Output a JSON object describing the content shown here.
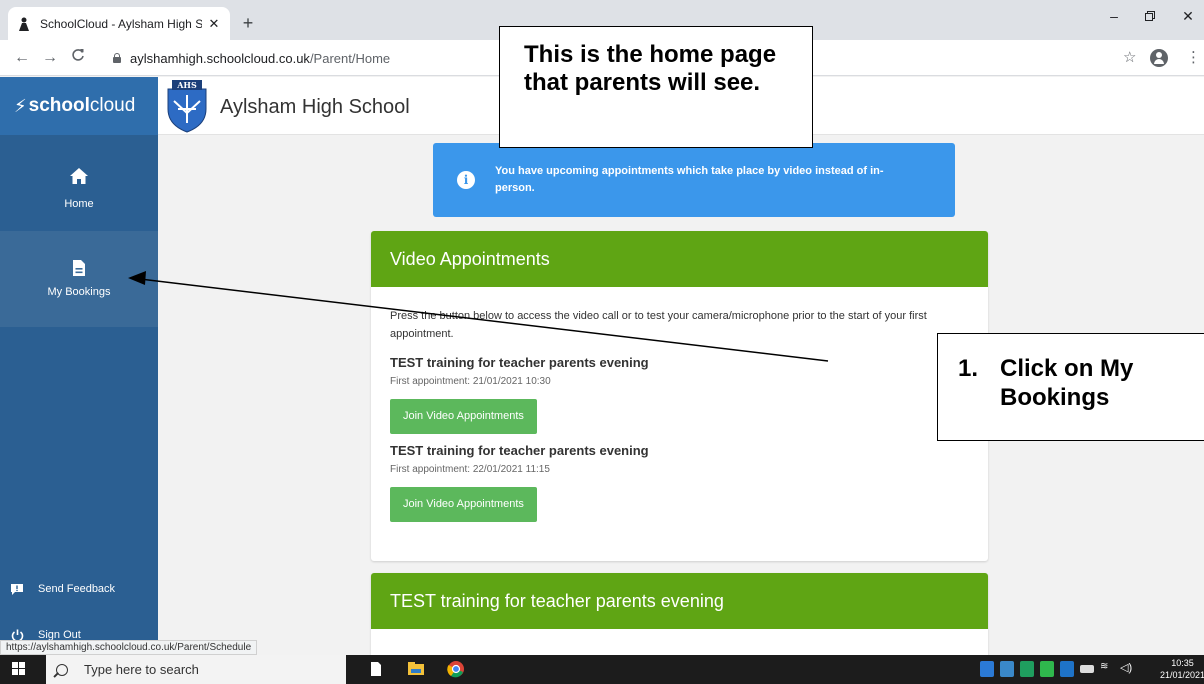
{
  "browser": {
    "tab_title": "SchoolCloud - Aylsham High Sch",
    "tab_close": "✕",
    "new_tab": "+",
    "url_host": "aylshamhigh.schoolcloud.co.uk",
    "url_path": "/Parent/Home",
    "status_url": "https://aylshamhigh.schoolcloud.co.uk/Parent/Schedule"
  },
  "header": {
    "brand_mark": "⚡",
    "brand_bold": "school",
    "brand_light": "cloud",
    "school_name": "Aylsham High School",
    "crest_text": "AHS"
  },
  "sidebar": {
    "items": [
      {
        "label": "Home",
        "icon": "home-icon"
      },
      {
        "label": "My Bookings",
        "icon": "document-icon"
      }
    ],
    "bottom": [
      {
        "label": "Send Feedback",
        "icon": "feedback-icon"
      },
      {
        "label": "Sign Out",
        "icon": "power-icon"
      }
    ]
  },
  "alert": {
    "icon_glyph": "i",
    "text": "You have upcoming appointments which take place by video instead of in-person."
  },
  "video_card": {
    "title": "Video Appointments",
    "intro": "Press the button below to access the video call or to test your camera/microphone prior to the start of your first appointment.",
    "events": [
      {
        "title": "TEST training for teacher parents evening",
        "first": "First appointment: 21/01/2021 10:30",
        "button": "Join Video Appointments"
      },
      {
        "title": "TEST training for teacher parents evening",
        "first": "First appointment: 22/01/2021 11:15",
        "button": "Join Video Appointments"
      }
    ]
  },
  "event_card": {
    "title": "TEST training for teacher parents evening"
  },
  "annotations": {
    "note1": "This is the home page that parents will see.",
    "note2_num": "1.",
    "note2_line1": "Click on My",
    "note2_line2": "Bookings"
  },
  "taskbar": {
    "search_placeholder": "Type here to search",
    "time": "10:35",
    "date": "21/01/2021"
  },
  "colors": {
    "sidebar": "#2b5f92",
    "card_header": "#5fa514",
    "alert": "#3b97eb",
    "join_button": "#5cb85c"
  }
}
